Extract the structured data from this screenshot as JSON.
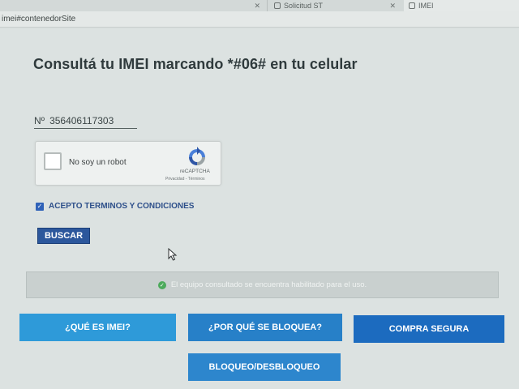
{
  "browser": {
    "tabs": [
      {
        "label": ""
      },
      {
        "label": "Solicitud ST"
      },
      {
        "label": "IMEI"
      }
    ],
    "url": "imei#contenedorSite"
  },
  "page": {
    "title": "Consultá tu IMEI marcando *#06# en tu celular",
    "imei_prefix": "Nº",
    "imei_value": "356406117303"
  },
  "captcha": {
    "label": "No soy un robot",
    "brand": "reCAPTCHA",
    "links": "Privacidad - Términos"
  },
  "terms": {
    "label": "ACEPTO TERMINOS Y CONDICIONES",
    "checked": true
  },
  "search_button": {
    "label": "BUSCAR"
  },
  "status": {
    "message": "El equipo consultado se encuentra habilitado para el uso.",
    "color": "#4caa5b"
  },
  "nav_buttons": [
    {
      "label": "¿QUÉ ES IMEI?"
    },
    {
      "label": "¿POR QUÉ SE BLOQUEA?"
    },
    {
      "label": "COMPRA SEGURA"
    },
    {
      "label": "BLOQUEO/DESBLOQUEO"
    }
  ]
}
